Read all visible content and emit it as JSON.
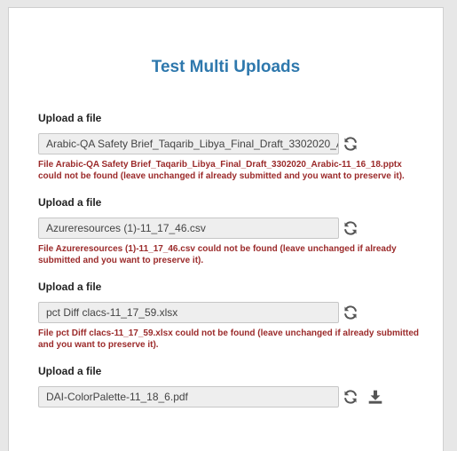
{
  "page": {
    "title": "Test Multi Uploads"
  },
  "uploads": [
    {
      "label": "Upload a file",
      "value": "Arabic-QA Safety Brief_Taqarib_Libya_Final_Draft_3302020_Arabic-11_16_18.pptx",
      "error": "File Arabic-QA Safety Brief_Taqarib_Libya_Final_Draft_3302020_Arabic-11_16_18.pptx could not be found (leave unchanged if already submitted and you want to preserve it)."
    },
    {
      "label": "Upload a file",
      "value": "Azureresources (1)-11_17_46.csv",
      "error": "File Azureresources (1)-11_17_46.csv could not be found (leave unchanged if already submitted and you want to preserve it)."
    },
    {
      "label": "Upload a file",
      "value": "pct Diff clacs-11_17_59.xlsx",
      "error": "File pct Diff clacs-11_17_59.xlsx could not be found (leave unchanged if already submitted and you want to preserve it)."
    },
    {
      "label": "Upload a file",
      "value": "DAI-ColorPalette-11_18_6.pdf",
      "error": null
    }
  ],
  "icons": {
    "refresh": "refresh-icon",
    "download": "download-icon"
  },
  "colors": {
    "title": "#2e78ad",
    "error": "#9b2a2a",
    "input_bg": "#eeeeee",
    "icon": "#555555"
  }
}
